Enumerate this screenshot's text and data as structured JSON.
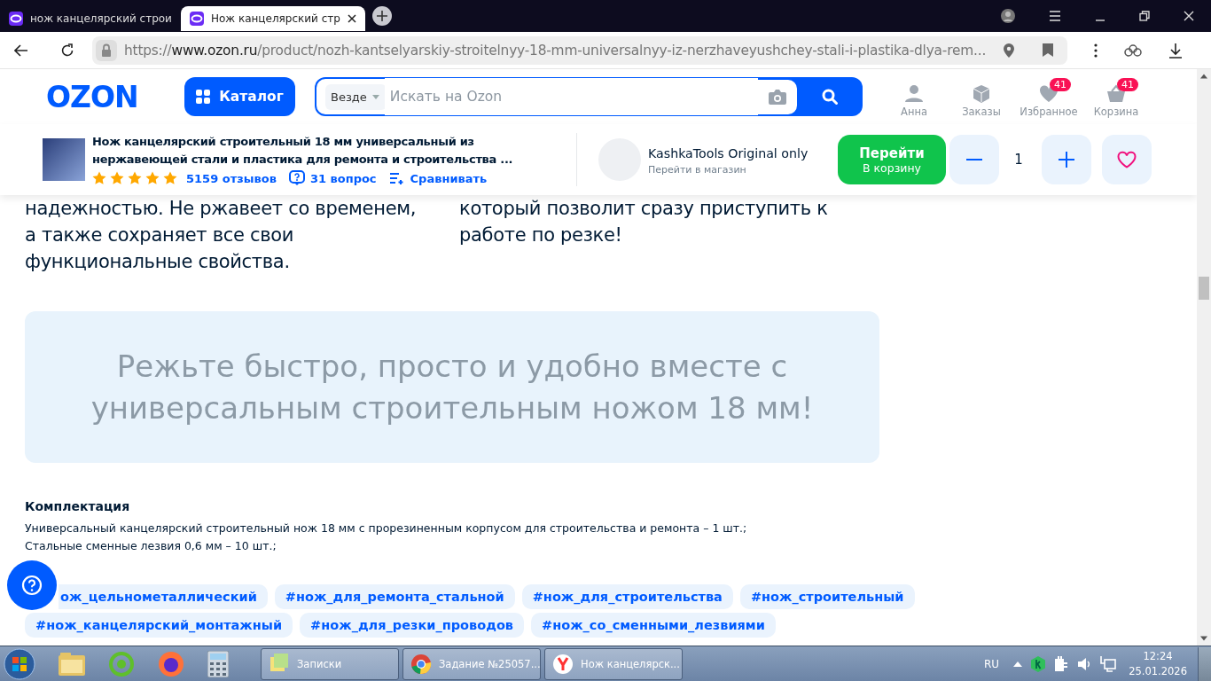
{
  "browser": {
    "tabs": [
      {
        "title": "нож канцелярский строи",
        "selected": false
      },
      {
        "title": "Нож канцелярский стр",
        "selected": true
      }
    ],
    "url": {
      "scheme": "https://",
      "host": "www.ozon.ru",
      "path": "/product/nozh-kantselyarskiy-stroitelnyy-18-mm-universalnyy-iz-nerzhaveyushchey-stali-i-plastika-dlya-rem..."
    }
  },
  "header": {
    "logo": "OZON",
    "catalog": "Каталог",
    "search_scope": "Везде",
    "search_placeholder": "Искать на Ozon",
    "nav": [
      {
        "kind": "user",
        "label": "Анна"
      },
      {
        "kind": "orders",
        "label": "Заказы"
      },
      {
        "kind": "favorites",
        "label": "Избранное",
        "badge": "41"
      },
      {
        "kind": "cart",
        "label": "Корзина",
        "badge": "41"
      }
    ]
  },
  "product_bar": {
    "title": "Нож канцелярский строительный 18 мм универсальный из нержавеющей стали и пластика для ремонта и строительства ...",
    "stars": 5,
    "reviews": "5159 отзывов",
    "questions": "31 вопрос",
    "compare": "Сравнивать",
    "seller": {
      "name": "KashkaTools Original only",
      "link": "Перейти в магазин"
    },
    "cart_button": {
      "label": "Перейти",
      "sublabel": "В корзину"
    },
    "quantity": "1"
  },
  "description": {
    "columns": [
      [
        "надежностью. Не ржавеет со временем,",
        "а также сохраняет все свои",
        "функциональные свойства."
      ],
      [
        "который позволит сразу приступить к",
        "работе по резке!"
      ]
    ],
    "banner": "Режьте быстро, просто и удобно вместе с универсальным строительным ножом 18 мм!",
    "kit_title": "Комплектация",
    "kit_lines": [
      "Универсальный канцелярский строительный нож 18 мм с прорезиненным корпусом для строительства и ремонта – 1 шт.;",
      "Стальные сменные лезвия 0,6 мм – 10 шт.;"
    ]
  },
  "tags": [
    [
      "ож_цельнометаллический",
      "#нож_для_ремонта_стальной",
      "#нож_для_строительства",
      "#нож_строительный"
    ],
    [
      "#нож_канцелярский_монтажный",
      "#нож_для_резки_проводов",
      "#нож_со_сменными_лезвиями"
    ]
  ],
  "taskbar": {
    "windows": [
      {
        "kind": "notes",
        "label": "Записки"
      },
      {
        "kind": "chrome",
        "label": "Задание №25057..."
      },
      {
        "kind": "yandex",
        "label": "Нож канцелярск..."
      }
    ],
    "language": "RU",
    "time": "12:24",
    "date": "25.01.2026"
  }
}
